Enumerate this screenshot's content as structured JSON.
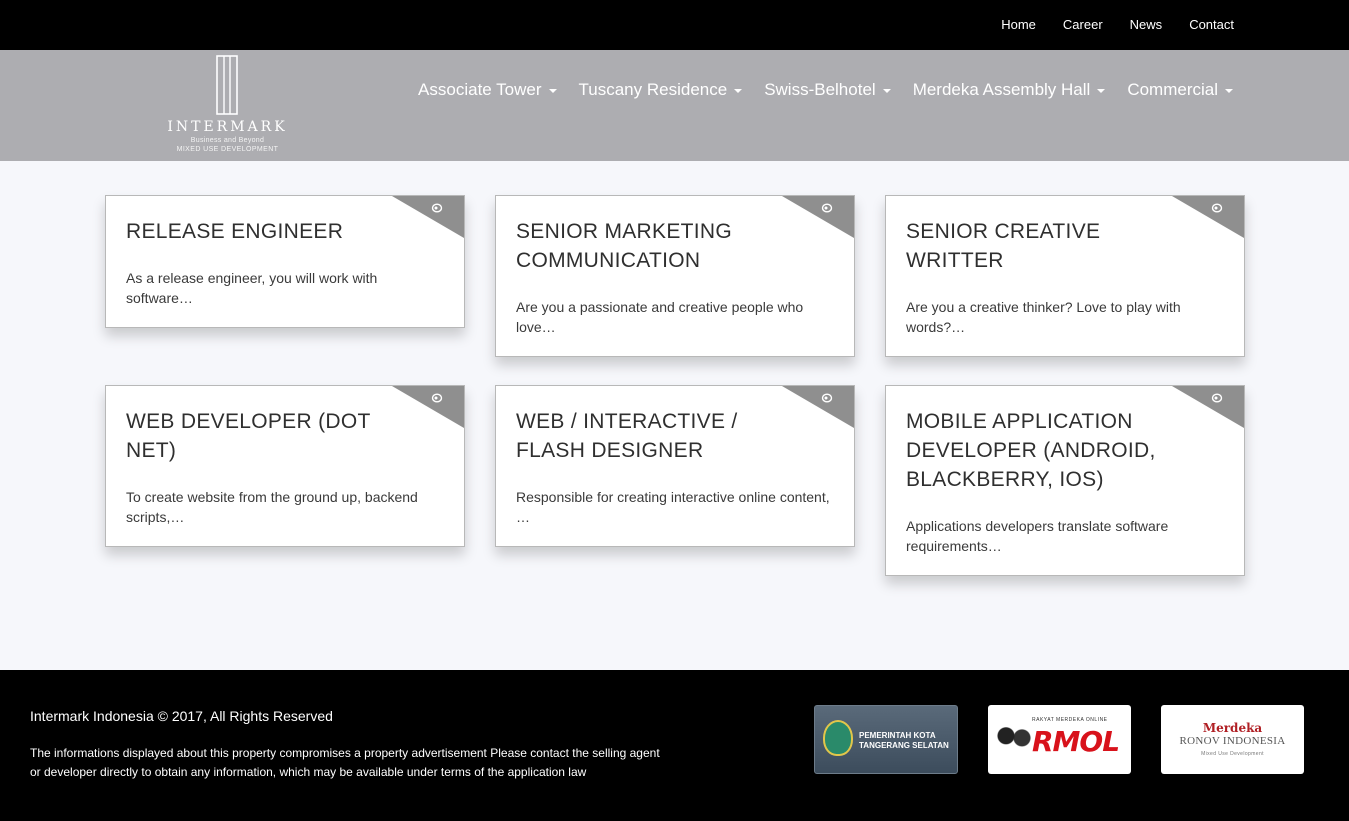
{
  "topnav": {
    "items": [
      "Home",
      "Career",
      "News",
      "Contact"
    ]
  },
  "logo": {
    "brand": "INTERMARK",
    "tagline": "Business and Beyond",
    "subtitle": "MIXED USE DEVELOPMENT"
  },
  "mainnav": {
    "items": [
      "Associate Tower",
      "Tuscany Residence",
      "Swiss-Belhotel",
      "Merdeka Assembly Hall",
      "Commercial"
    ]
  },
  "jobs": [
    {
      "title": "RELEASE ENGINEER",
      "excerpt": "As a release engineer, you will work with software…"
    },
    {
      "title": "SENIOR MARKETING COMMUNICATION",
      "excerpt": "Are you a passionate and creative people who love…"
    },
    {
      "title": "SENIOR CREATIVE WRITTER",
      "excerpt": "Are you a creative thinker? Love to play with words?…"
    },
    {
      "title": "WEB DEVELOPER (DOT NET)",
      "excerpt": "To create website from the ground up, backend scripts,…"
    },
    {
      "title": "WEB / INTERACTIVE / FLASH DESIGNER",
      "excerpt": "Responsible for creating interactive online content, …"
    },
    {
      "title": "MOBILE APPLICATION DEVELOPER (ANDROID, BLACKBERRY, IOS)",
      "excerpt": "Applications developers translate software requirements…"
    }
  ],
  "footer": {
    "copyright": "Intermark Indonesia © 2017, All Rights Reserved",
    "disclaimer": "The informations displayed about this property compromises a property advertisement Please contact the selling agent or developer directly to obtain any information, which may be available under terms of the application law",
    "partners": {
      "tangsel": "PEMERINTAH KOTA TANGERANG SELATAN",
      "rmol_top": "RAKYAT MERDEKA ONLINE",
      "rmol": "RMOL",
      "merdeka": "Merdeka",
      "ronov": "RONOV INDONESIA",
      "ronov_sub": "Mixed Use Development"
    }
  }
}
